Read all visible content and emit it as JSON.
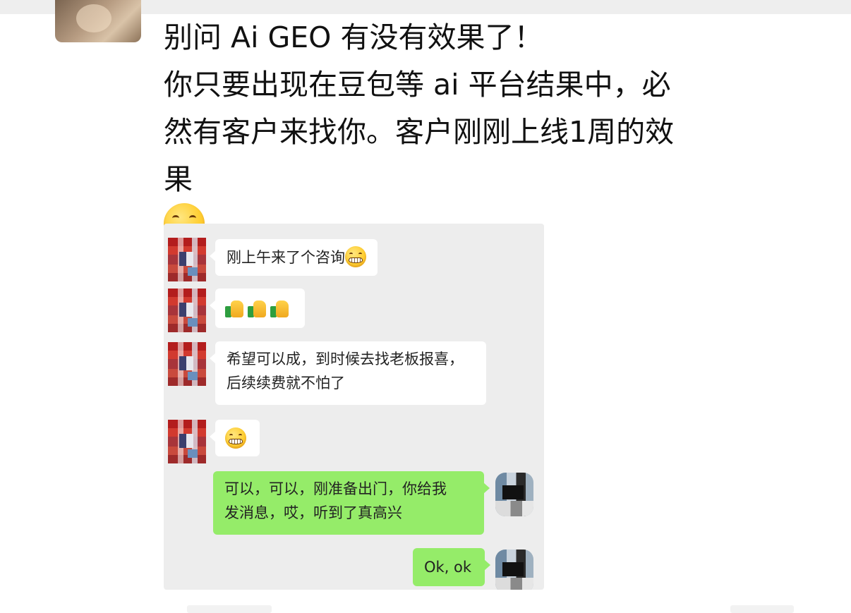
{
  "post": {
    "lines": [
      "别问 Ai GEO 有没有效果了！",
      "你只要出现在豆包等 ai 平台结果中，必",
      "然有客户来找你。客户刚刚上线1周的效",
      "果"
    ],
    "emoji": "grinning-face"
  },
  "chat": {
    "messages": [
      {
        "side": "left",
        "text": "刚上午来了个咨询",
        "emoji": "grinning-face"
      },
      {
        "side": "left",
        "emoji": "thumbs-up x3"
      },
      {
        "side": "left",
        "lines": [
          "希望可以成，到时候去找老板报喜，",
          "后续续费就不怕了"
        ]
      },
      {
        "side": "left",
        "emoji": "grinning-face"
      },
      {
        "side": "right",
        "lines": [
          "可以，可以，刚准备出门，你给我",
          "发消息，哎，听到了真高兴"
        ]
      },
      {
        "side": "right",
        "text": "Ok, ok"
      }
    ]
  },
  "colors": {
    "chat_background": "#ededed",
    "incoming_bubble": "#ffffff",
    "outgoing_bubble": "#95ec69",
    "text": "#111111"
  }
}
